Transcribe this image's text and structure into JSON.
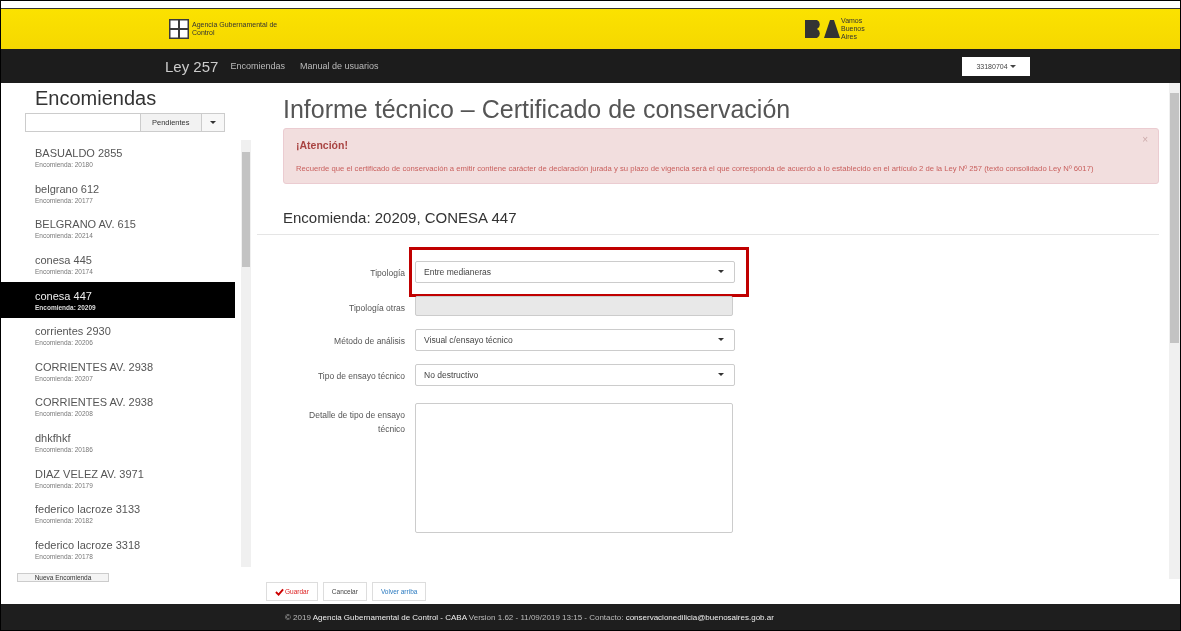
{
  "header": {
    "agency_logo_text": "Agencia Gubernamental de Control",
    "city_logo_text": "Vamos Buenos Aires"
  },
  "navbar": {
    "brand": "Ley 257",
    "links": [
      "Encomiendas",
      "Manual de usuarios"
    ],
    "user_menu": "33180704"
  },
  "sidebar": {
    "title": "Encomiendas",
    "filter_button": "Pendientes",
    "items": [
      {
        "name": "BASUALDO 2855",
        "subtitle": "Encomienda: 20180",
        "selected": false
      },
      {
        "name": "belgrano 612",
        "subtitle": "Encomienda: 20177",
        "selected": false
      },
      {
        "name": "BELGRANO AV. 615",
        "subtitle": "Encomienda: 20214",
        "selected": false
      },
      {
        "name": "conesa 445",
        "subtitle": "Encomienda: 20174",
        "selected": false
      },
      {
        "name": "conesa 447",
        "subtitle": "Encomienda: 20209",
        "selected": true
      },
      {
        "name": "corrientes 2930",
        "subtitle": "Encomienda: 20206",
        "selected": false
      },
      {
        "name": "CORRIENTES AV. 2938",
        "subtitle": "Encomienda: 20207",
        "selected": false
      },
      {
        "name": "CORRIENTES AV. 2938",
        "subtitle": "Encomienda: 20208",
        "selected": false
      },
      {
        "name": "dhkfhkf",
        "subtitle": "Encomienda: 20186",
        "selected": false
      },
      {
        "name": "DIAZ VELEZ AV. 3971",
        "subtitle": "Encomienda: 20179",
        "selected": false
      },
      {
        "name": "federico lacroze 3133",
        "subtitle": "Encomienda: 20182",
        "selected": false
      },
      {
        "name": "federico lacroze 3318",
        "subtitle": "Encomienda: 20178",
        "selected": false
      }
    ],
    "new_button": "Nueva Encomienda"
  },
  "main": {
    "title": "Informe técnico – Certificado de conservación",
    "alert": {
      "title": "¡Atención!",
      "close": "×",
      "text": "Recuerde que el certificado de conservación a emitir contiene carácter de declaración jurada y su plazo de vigencia será el que corresponda de acuerdo a lo establecido en el artículo 2 de la Ley Nº 257 (texto consolidado Ley Nº 6017)"
    },
    "heading": "Encomienda: 20209, CONESA 447",
    "fields": [
      {
        "kind": "select",
        "label": "Tipología",
        "value": "Entre medianeras",
        "disabled": false,
        "highlighted": true
      },
      {
        "kind": "text",
        "label": "Tipología otras",
        "disabled": true,
        "highlighted": false
      },
      {
        "kind": "select",
        "label": "Método de análisis",
        "value": "Visual c/ensayo técnico",
        "disabled": false,
        "highlighted": false
      },
      {
        "kind": "select",
        "label": "Tipo de ensayo técnico",
        "value": "No destructivo",
        "disabled": false,
        "highlighted": false
      },
      {
        "kind": "textarea",
        "label": "Detalle de tipo de ensayo técnico",
        "disabled": false,
        "highlighted": false
      }
    ],
    "buttons": [
      {
        "label": "Guardar",
        "kind": "save"
      },
      {
        "label": "Cancelar",
        "kind": "plain"
      },
      {
        "label": "Volver arriba",
        "kind": "link"
      }
    ]
  },
  "footer": {
    "prefix": "© 2019",
    "agency": "Agencia Gubernamental de Control - CABA",
    "version": "Version 1.62 - 11/09/2019 13:15 - Contacto:",
    "email": "conservacionedilicia@buenosaires.gob.ar"
  }
}
